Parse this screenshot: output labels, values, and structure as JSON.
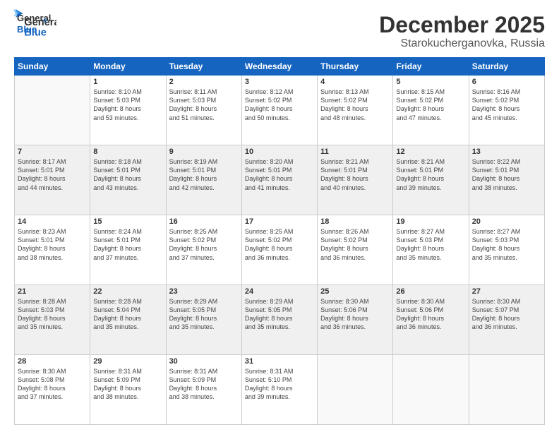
{
  "logo": {
    "line1": "General",
    "line2": "Blue"
  },
  "title": "December 2025",
  "subtitle": "Starokucherganovka, Russia",
  "headers": [
    "Sunday",
    "Monday",
    "Tuesday",
    "Wednesday",
    "Thursday",
    "Friday",
    "Saturday"
  ],
  "weeks": [
    [
      {
        "day": "",
        "info": ""
      },
      {
        "day": "1",
        "info": "Sunrise: 8:10 AM\nSunset: 5:03 PM\nDaylight: 8 hours\nand 53 minutes."
      },
      {
        "day": "2",
        "info": "Sunrise: 8:11 AM\nSunset: 5:03 PM\nDaylight: 8 hours\nand 51 minutes."
      },
      {
        "day": "3",
        "info": "Sunrise: 8:12 AM\nSunset: 5:02 PM\nDaylight: 8 hours\nand 50 minutes."
      },
      {
        "day": "4",
        "info": "Sunrise: 8:13 AM\nSunset: 5:02 PM\nDaylight: 8 hours\nand 48 minutes."
      },
      {
        "day": "5",
        "info": "Sunrise: 8:15 AM\nSunset: 5:02 PM\nDaylight: 8 hours\nand 47 minutes."
      },
      {
        "day": "6",
        "info": "Sunrise: 8:16 AM\nSunset: 5:02 PM\nDaylight: 8 hours\nand 45 minutes."
      }
    ],
    [
      {
        "day": "7",
        "info": "Sunrise: 8:17 AM\nSunset: 5:01 PM\nDaylight: 8 hours\nand 44 minutes."
      },
      {
        "day": "8",
        "info": "Sunrise: 8:18 AM\nSunset: 5:01 PM\nDaylight: 8 hours\nand 43 minutes."
      },
      {
        "day": "9",
        "info": "Sunrise: 8:19 AM\nSunset: 5:01 PM\nDaylight: 8 hours\nand 42 minutes."
      },
      {
        "day": "10",
        "info": "Sunrise: 8:20 AM\nSunset: 5:01 PM\nDaylight: 8 hours\nand 41 minutes."
      },
      {
        "day": "11",
        "info": "Sunrise: 8:21 AM\nSunset: 5:01 PM\nDaylight: 8 hours\nand 40 minutes."
      },
      {
        "day": "12",
        "info": "Sunrise: 8:21 AM\nSunset: 5:01 PM\nDaylight: 8 hours\nand 39 minutes."
      },
      {
        "day": "13",
        "info": "Sunrise: 8:22 AM\nSunset: 5:01 PM\nDaylight: 8 hours\nand 38 minutes."
      }
    ],
    [
      {
        "day": "14",
        "info": "Sunrise: 8:23 AM\nSunset: 5:01 PM\nDaylight: 8 hours\nand 38 minutes."
      },
      {
        "day": "15",
        "info": "Sunrise: 8:24 AM\nSunset: 5:01 PM\nDaylight: 8 hours\nand 37 minutes."
      },
      {
        "day": "16",
        "info": "Sunrise: 8:25 AM\nSunset: 5:02 PM\nDaylight: 8 hours\nand 37 minutes."
      },
      {
        "day": "17",
        "info": "Sunrise: 8:25 AM\nSunset: 5:02 PM\nDaylight: 8 hours\nand 36 minutes."
      },
      {
        "day": "18",
        "info": "Sunrise: 8:26 AM\nSunset: 5:02 PM\nDaylight: 8 hours\nand 36 minutes."
      },
      {
        "day": "19",
        "info": "Sunrise: 8:27 AM\nSunset: 5:03 PM\nDaylight: 8 hours\nand 35 minutes."
      },
      {
        "day": "20",
        "info": "Sunrise: 8:27 AM\nSunset: 5:03 PM\nDaylight: 8 hours\nand 35 minutes."
      }
    ],
    [
      {
        "day": "21",
        "info": "Sunrise: 8:28 AM\nSunset: 5:03 PM\nDaylight: 8 hours\nand 35 minutes."
      },
      {
        "day": "22",
        "info": "Sunrise: 8:28 AM\nSunset: 5:04 PM\nDaylight: 8 hours\nand 35 minutes."
      },
      {
        "day": "23",
        "info": "Sunrise: 8:29 AM\nSunset: 5:05 PM\nDaylight: 8 hours\nand 35 minutes."
      },
      {
        "day": "24",
        "info": "Sunrise: 8:29 AM\nSunset: 5:05 PM\nDaylight: 8 hours\nand 35 minutes."
      },
      {
        "day": "25",
        "info": "Sunrise: 8:30 AM\nSunset: 5:06 PM\nDaylight: 8 hours\nand 36 minutes."
      },
      {
        "day": "26",
        "info": "Sunrise: 8:30 AM\nSunset: 5:06 PM\nDaylight: 8 hours\nand 36 minutes."
      },
      {
        "day": "27",
        "info": "Sunrise: 8:30 AM\nSunset: 5:07 PM\nDaylight: 8 hours\nand 36 minutes."
      }
    ],
    [
      {
        "day": "28",
        "info": "Sunrise: 8:30 AM\nSunset: 5:08 PM\nDaylight: 8 hours\nand 37 minutes."
      },
      {
        "day": "29",
        "info": "Sunrise: 8:31 AM\nSunset: 5:09 PM\nDaylight: 8 hours\nand 38 minutes."
      },
      {
        "day": "30",
        "info": "Sunrise: 8:31 AM\nSunset: 5:09 PM\nDaylight: 8 hours\nand 38 minutes."
      },
      {
        "day": "31",
        "info": "Sunrise: 8:31 AM\nSunset: 5:10 PM\nDaylight: 8 hours\nand 39 minutes."
      },
      {
        "day": "",
        "info": ""
      },
      {
        "day": "",
        "info": ""
      },
      {
        "day": "",
        "info": ""
      }
    ]
  ]
}
